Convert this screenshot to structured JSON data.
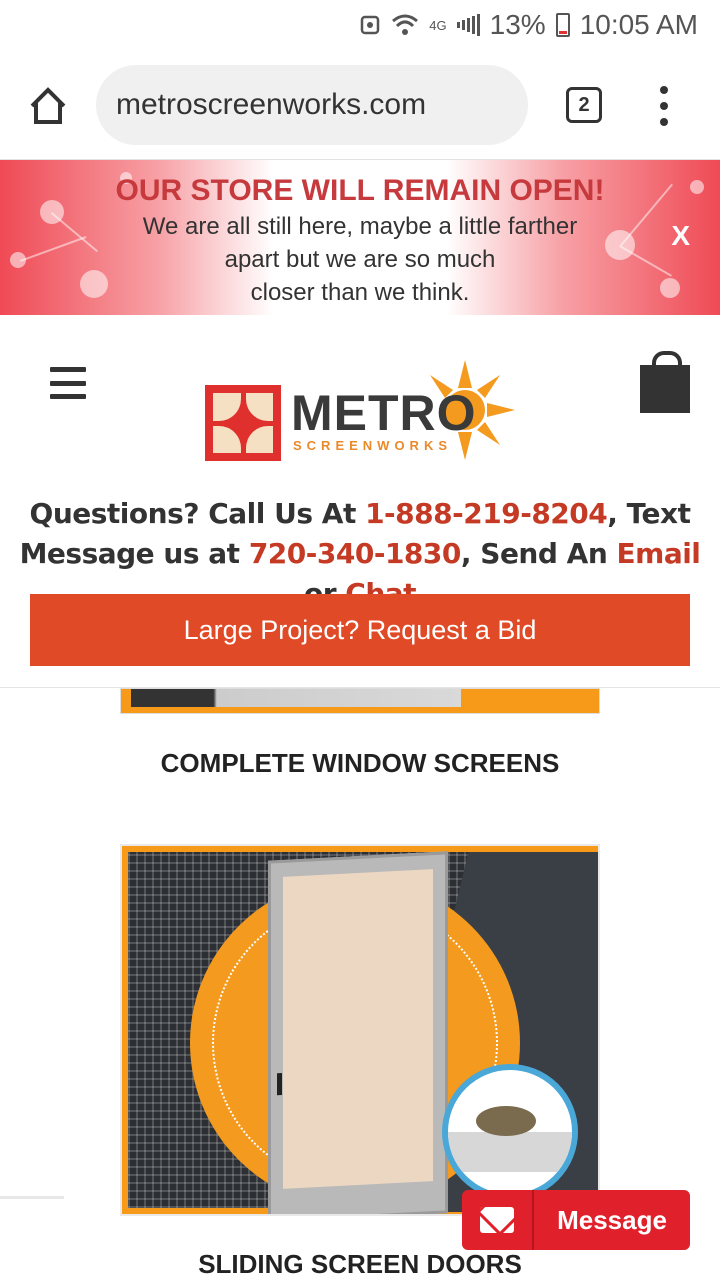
{
  "status_bar": {
    "battery": "13%",
    "time": "10:05 AM",
    "network": "4G"
  },
  "browser": {
    "url": "metroscreenworks.com",
    "tab_count": "2"
  },
  "banner": {
    "title": "OUR STORE WILL REMAIN OPEN!",
    "line1": "We are all still here, maybe a little farther",
    "line2": "apart but we are so much",
    "line3": "closer than we think.",
    "close": "X"
  },
  "header": {
    "logo_text": "METRO",
    "logo_subtext": "SCREENWORKS"
  },
  "contact": {
    "prefix": "Questions? Call Us At ",
    "phone": "1-888-219-8204",
    "text_label": ", Text Message us at ",
    "text_number": "720-340-1830",
    "send_label": ", Send An ",
    "email": "Email",
    "or_label": " or ",
    "chat": "Chat"
  },
  "bid_button": "Large Project? Request a Bid",
  "products": [
    {
      "title": "COMPLETE WINDOW SCREENS"
    },
    {
      "title": "SLIDING SCREEN DOORS"
    }
  ],
  "message_button": "Message",
  "colors": {
    "accent_orange": "#e04a26",
    "link_red": "#c43a24",
    "banner_red": "#ef4a55",
    "message_red": "#e0202b",
    "product_orange": "#f79a1a"
  },
  "icons": [
    "home-icon",
    "tabs-icon",
    "more-vert-icon",
    "hamburger-icon",
    "cart-bag-icon",
    "envelope-icon",
    "close-icon"
  ]
}
